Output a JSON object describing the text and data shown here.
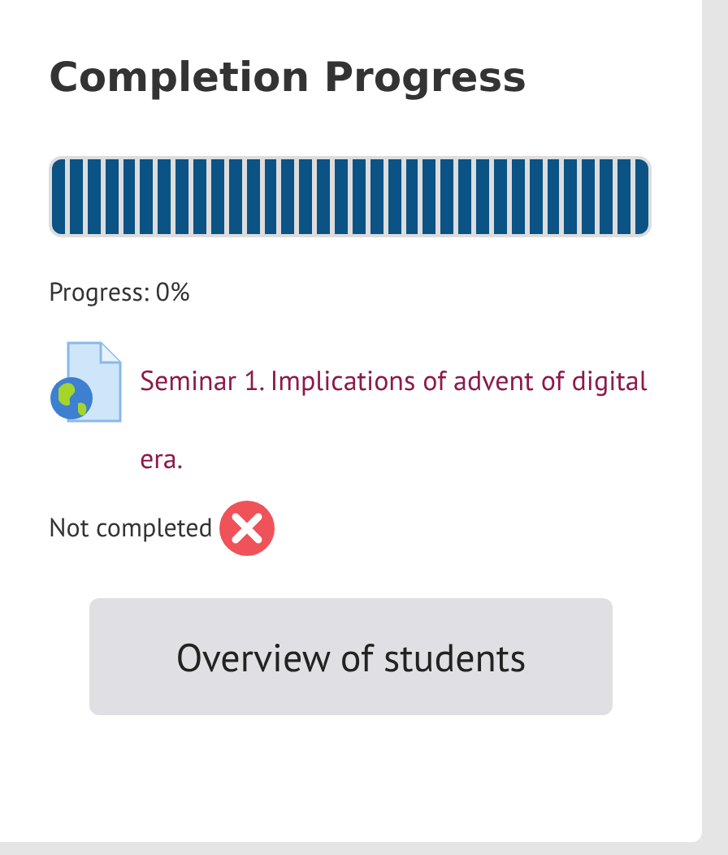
{
  "block": {
    "title": "Completion Progress",
    "segments": [
      {
        "completed": false
      },
      {
        "completed": false
      },
      {
        "completed": false
      },
      {
        "completed": false
      },
      {
        "completed": false
      },
      {
        "completed": false
      },
      {
        "completed": false
      },
      {
        "completed": false
      },
      {
        "completed": false
      },
      {
        "completed": false
      },
      {
        "completed": false
      },
      {
        "completed": false
      },
      {
        "completed": false
      },
      {
        "completed": false
      },
      {
        "completed": false
      },
      {
        "completed": false
      },
      {
        "completed": false
      },
      {
        "completed": false
      },
      {
        "completed": false
      },
      {
        "completed": false
      },
      {
        "completed": false
      },
      {
        "completed": false
      },
      {
        "completed": false
      },
      {
        "completed": false
      },
      {
        "completed": false
      },
      {
        "completed": false
      },
      {
        "completed": false
      },
      {
        "completed": false
      },
      {
        "completed": false
      },
      {
        "completed": false
      },
      {
        "completed": false
      },
      {
        "completed": false
      },
      {
        "completed": false
      },
      {
        "completed": false
      }
    ],
    "progress": "Progress: 0%",
    "activity": {
      "title": "Seminar 1. Implications of advent of digital era.",
      "completed": false,
      "status": "Not completed"
    },
    "button": "Overview of students"
  }
}
